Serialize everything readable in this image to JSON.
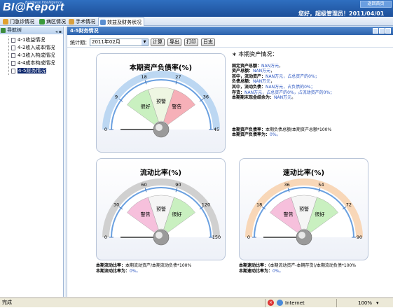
{
  "app": {
    "logo": "BI@Report",
    "logo_sub": "Business Intelligence",
    "welcome": "您好，超级管理员！2011/04/01",
    "home_btn": "返回首页"
  },
  "tabs": [
    {
      "label": "门急诊情况",
      "color": "#e0a030"
    },
    {
      "label": "病区情况",
      "color": "#3a9a3a"
    },
    {
      "label": "手术情况",
      "color": "#d8a040"
    },
    {
      "label": "效益及财务状况",
      "color": "#5b8fd0"
    }
  ],
  "sidebar": {
    "title": "导航树",
    "items": [
      "4-1收益情况",
      "4-2收入成本情况",
      "4-3收入构成情况",
      "4-4成本构成情况",
      "4-5财务情况"
    ]
  },
  "main": {
    "title": "4-5财务情况"
  },
  "toolbar": {
    "period_label": "统计期：",
    "period_value": "2011年02月",
    "calc": "计算",
    "export": "导出",
    "print": "打印",
    "log": "日志"
  },
  "colors": {
    "good": "#c9f0c0",
    "warn": "#f0f6e4",
    "alarm": "#f6b0b8"
  },
  "gauges": [
    {
      "title": "本期资产负债率(%)",
      "min": 0,
      "max": 45,
      "ticks": [
        0,
        9,
        18,
        27,
        36,
        45
      ],
      "value": 0,
      "zones": [
        {
          "label": "很好",
          "from": 9,
          "to": 18,
          "color": "#c9f0c0"
        },
        {
          "label": "预警",
          "from": 18,
          "to": 27,
          "color": "#eef6e2"
        },
        {
          "label": "警告",
          "from": 27,
          "to": 36,
          "color": "#f6b0b8"
        }
      ]
    },
    {
      "title": "流动比率(%)",
      "min": 0,
      "max": 150,
      "ticks": [
        0,
        30,
        60,
        90,
        120,
        150
      ],
      "value": 0,
      "zones": [
        {
          "label": "警告",
          "from": 30,
          "to": 60,
          "color": "#f6c0dc"
        },
        {
          "label": "预警",
          "from": 60,
          "to": 90,
          "color": "#f5f5f5"
        },
        {
          "label": "很好",
          "from": 90,
          "to": 120,
          "color": "#c9f0c0"
        }
      ]
    },
    {
      "title": "速动比率(%)",
      "min": 0,
      "max": 90,
      "ticks": [
        0,
        18,
        36,
        54,
        72,
        90
      ],
      "value": 0,
      "zones": [
        {
          "label": "警告",
          "from": 18,
          "to": 36,
          "color": "#f6c0dc"
        },
        {
          "label": "预警",
          "from": 36,
          "to": 54,
          "color": "#f5f5f5"
        },
        {
          "label": "很好",
          "from": 54,
          "to": 72,
          "color": "#c9f0c0"
        }
      ]
    }
  ],
  "info": {
    "heading": "本期资产情况：",
    "lines": [
      {
        "b": "固定资产总额：",
        "v": "NAN万元",
        "t": "，"
      },
      {
        "b": "资产总额：",
        "v": "NAN万元",
        "t": "，"
      },
      {
        "b": "",
        "t0": "其中，流动资产：",
        "v": "NAN万元",
        "t": "，占总资产的0%；"
      },
      {
        "b": "负债总额：",
        "v": "NAN万元",
        "t": "，"
      },
      {
        "b": "",
        "t0": "其中，流动负债：",
        "v": "NAN万元",
        "t": "，占负债的0%；"
      },
      {
        "b": "",
        "t0": "存货：",
        "v": "NAN万元",
        "t": "，占总资产的0%，占流动资产的0%；"
      },
      {
        "b": "本期期末现金结余为：",
        "v": "NAN万元",
        "t": "。"
      }
    ],
    "f1a": "本期资产负债率：",
    "f1b": "本期负债总额/本期资产总额*100%",
    "f2a": "本期资产负债率为：",
    "f2b": "0%。"
  },
  "formula2": {
    "a": "本期流动比率：",
    "b": "本期流动资产/本期流动负债*100%",
    "c": "本期流动比率为：",
    "d": "0%。"
  },
  "formula3": {
    "a": "本期速动比率：",
    "b": "(本期流动资产-本期存货)/本期流动负债*100%",
    "c": "本期速动比率为：",
    "d": "0%。"
  },
  "status": {
    "left": "完成",
    "zone": "Internet",
    "zoom": "100%"
  }
}
